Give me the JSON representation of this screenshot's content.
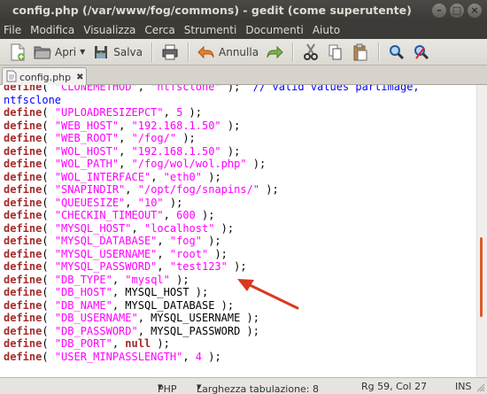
{
  "window": {
    "title": "config.php (/var/www/fog/commons) - gedit (come superutente)"
  },
  "menubar": {
    "items": [
      "File",
      "Modifica",
      "Visualizza",
      "Cerca",
      "Strumenti",
      "Documenti",
      "Aiuto"
    ]
  },
  "toolbar": {
    "open_label": "Apri",
    "save_label": "Salva",
    "undo_label": "Annulla"
  },
  "tab": {
    "label": "config.php",
    "close": "✖"
  },
  "code_lines": [
    [
      [
        "kw",
        "define"
      ],
      [
        "p",
        "( "
      ],
      [
        "str",
        "\"CLONEMETHOD\""
      ],
      [
        "p",
        ", "
      ],
      [
        "str",
        "\"ntfsclone\""
      ],
      [
        "p",
        " );  "
      ],
      [
        "cmt",
        "// valid values partimage,"
      ]
    ],
    [
      [
        "cmt",
        "ntfsclone"
      ]
    ],
    [
      [
        "kw",
        "define"
      ],
      [
        "p",
        "( "
      ],
      [
        "str",
        "\"UPLOADRESIZEPCT\""
      ],
      [
        "p",
        ", "
      ],
      [
        "num",
        "5"
      ],
      [
        "p",
        " );"
      ]
    ],
    [
      [
        "kw",
        "define"
      ],
      [
        "p",
        "( "
      ],
      [
        "str",
        "\"WEB_HOST\""
      ],
      [
        "p",
        ", "
      ],
      [
        "str",
        "\"192.168.1.50\""
      ],
      [
        "p",
        " );"
      ]
    ],
    [
      [
        "kw",
        "define"
      ],
      [
        "p",
        "( "
      ],
      [
        "str",
        "\"WEB_ROOT\""
      ],
      [
        "p",
        ", "
      ],
      [
        "str",
        "\"/fog/\""
      ],
      [
        "p",
        " );"
      ]
    ],
    [
      [
        "kw",
        "define"
      ],
      [
        "p",
        "( "
      ],
      [
        "str",
        "\"WOL_HOST\""
      ],
      [
        "p",
        ", "
      ],
      [
        "str",
        "\"192.168.1.50\""
      ],
      [
        "p",
        " );"
      ]
    ],
    [
      [
        "kw",
        "define"
      ],
      [
        "p",
        "( "
      ],
      [
        "str",
        "\"WOL_PATH\""
      ],
      [
        "p",
        ", "
      ],
      [
        "str",
        "\"/fog/wol/wol.php\""
      ],
      [
        "p",
        " );"
      ]
    ],
    [
      [
        "kw",
        "define"
      ],
      [
        "p",
        "( "
      ],
      [
        "str",
        "\"WOL_INTERFACE\""
      ],
      [
        "p",
        ", "
      ],
      [
        "str",
        "\"eth0\""
      ],
      [
        "p",
        " );"
      ]
    ],
    [
      [
        "kw",
        "define"
      ],
      [
        "p",
        "( "
      ],
      [
        "str",
        "\"SNAPINDIR\""
      ],
      [
        "p",
        ", "
      ],
      [
        "str",
        "\"/opt/fog/snapins/\""
      ],
      [
        "p",
        " );"
      ]
    ],
    [
      [
        "kw",
        "define"
      ],
      [
        "p",
        "( "
      ],
      [
        "str",
        "\"QUEUESIZE\""
      ],
      [
        "p",
        ", "
      ],
      [
        "str",
        "\"10\""
      ],
      [
        "p",
        " );"
      ]
    ],
    [
      [
        "kw",
        "define"
      ],
      [
        "p",
        "( "
      ],
      [
        "str",
        "\"CHECKIN_TIMEOUT\""
      ],
      [
        "p",
        ", "
      ],
      [
        "num",
        "600"
      ],
      [
        "p",
        " );"
      ]
    ],
    [
      [
        "kw",
        "define"
      ],
      [
        "p",
        "( "
      ],
      [
        "str",
        "\"MYSQL_HOST\""
      ],
      [
        "p",
        ", "
      ],
      [
        "str",
        "\"localhost\""
      ],
      [
        "p",
        " );"
      ]
    ],
    [
      [
        "kw",
        "define"
      ],
      [
        "p",
        "( "
      ],
      [
        "str",
        "\"MYSQL_DATABASE\""
      ],
      [
        "p",
        ", "
      ],
      [
        "str",
        "\"fog\""
      ],
      [
        "p",
        " );"
      ]
    ],
    [
      [
        "kw",
        "define"
      ],
      [
        "p",
        "( "
      ],
      [
        "str",
        "\"MYSQL_USERNAME\""
      ],
      [
        "p",
        ", "
      ],
      [
        "str",
        "\"root\""
      ],
      [
        "p",
        " );"
      ]
    ],
    [
      [
        "kw",
        "define"
      ],
      [
        "p",
        "( "
      ],
      [
        "str",
        "\"MYSQL_PASSWORD\""
      ],
      [
        "p",
        ", "
      ],
      [
        "str",
        "\"test123\""
      ],
      [
        "p",
        " );"
      ]
    ],
    [
      [
        "kw",
        "define"
      ],
      [
        "p",
        "( "
      ],
      [
        "str",
        "\"DB_TYPE\""
      ],
      [
        "p",
        ", "
      ],
      [
        "str",
        "\"mysql\""
      ],
      [
        "p",
        " );"
      ]
    ],
    [
      [
        "kw",
        "define"
      ],
      [
        "p",
        "( "
      ],
      [
        "str",
        "\"DB_HOST\""
      ],
      [
        "p",
        ", MYSQL_HOST );"
      ]
    ],
    [
      [
        "kw",
        "define"
      ],
      [
        "p",
        "( "
      ],
      [
        "str",
        "\"DB_NAME\""
      ],
      [
        "p",
        ", MYSQL_DATABASE );"
      ]
    ],
    [
      [
        "kw",
        "define"
      ],
      [
        "p",
        "( "
      ],
      [
        "str",
        "\"DB_USERNAME\""
      ],
      [
        "p",
        ", MYSQL_USERNAME );"
      ]
    ],
    [
      [
        "kw",
        "define"
      ],
      [
        "p",
        "( "
      ],
      [
        "str",
        "\"DB_PASSWORD\""
      ],
      [
        "p",
        ", MYSQL_PASSWORD );"
      ]
    ],
    [
      [
        "kw",
        "define"
      ],
      [
        "p",
        "( "
      ],
      [
        "str",
        "\"DB_PORT\""
      ],
      [
        "p",
        ", "
      ],
      [
        "kw",
        "null"
      ],
      [
        "p",
        " );"
      ]
    ],
    [
      [
        "kw",
        "define"
      ],
      [
        "p",
        "( "
      ],
      [
        "str",
        "\"USER_MINPASSLENGTH\""
      ],
      [
        "p",
        ", "
      ],
      [
        "num",
        "4"
      ],
      [
        "p",
        " );"
      ]
    ]
  ],
  "statusbar": {
    "language": "PHP",
    "tab_width": "Larghezza tabulazione: 8",
    "position": "Rg 59, Col 27",
    "mode": "INS"
  },
  "colors": {
    "keyword": "#a52a2a",
    "string": "#ff00ff",
    "comment": "#0000ff",
    "annotation_arrow": "#d9391e"
  }
}
